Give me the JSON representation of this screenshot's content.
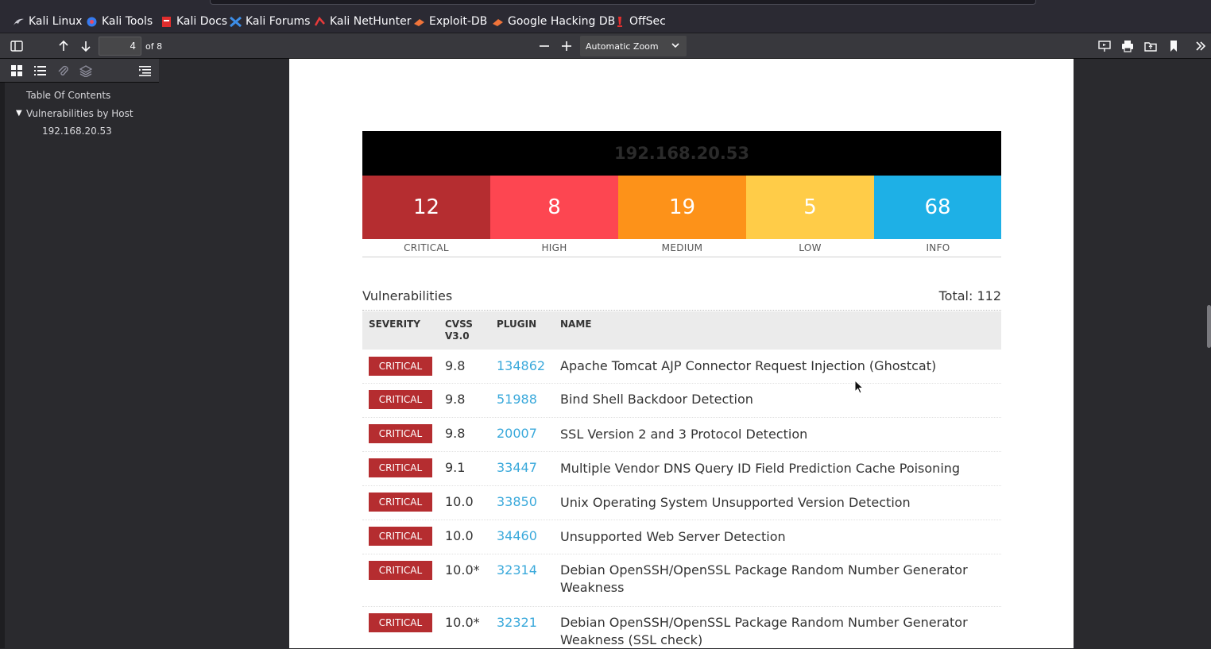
{
  "bookmarks": [
    {
      "label": "Kali Linux",
      "icon": "kali-dragon-icon"
    },
    {
      "label": "Kali Tools",
      "icon": "kali-tools-icon"
    },
    {
      "label": "Kali Docs",
      "icon": "kali-docs-icon"
    },
    {
      "label": "Kali Forums",
      "icon": "kali-forums-icon"
    },
    {
      "label": "Kali NetHunter",
      "icon": "kali-nethunter-icon"
    },
    {
      "label": "Exploit-DB",
      "icon": "exploit-db-icon"
    },
    {
      "label": "Google Hacking DB",
      "icon": "ghdb-icon"
    },
    {
      "label": "OffSec",
      "icon": "offsec-icon"
    }
  ],
  "toolbar": {
    "page_number": "4",
    "page_count_label": "of 8",
    "zoom_label": "Automatic Zoom"
  },
  "outline": {
    "items": [
      "Table Of Contents",
      "Vulnerabilities by Host",
      "192.168.20.53"
    ]
  },
  "report": {
    "host": "192.168.20.53",
    "severity_counts": [
      {
        "label": "CRITICAL",
        "count": "12",
        "color": "#b52d30"
      },
      {
        "label": "HIGH",
        "count": "8",
        "color": "#fd4651"
      },
      {
        "label": "MEDIUM",
        "count": "19",
        "color": "#fd9219"
      },
      {
        "label": "LOW",
        "count": "5",
        "color": "#ffcc48"
      },
      {
        "label": "INFO",
        "count": "68",
        "color": "#1eb0e6"
      }
    ],
    "vulnerabilities_title": "Vulnerabilities",
    "total_label": "Total: 112",
    "columns": [
      "SEVERITY",
      "CVSS V3.0",
      "PLUGIN",
      "NAME"
    ],
    "rows": [
      {
        "severity": "CRITICAL",
        "cvss": "9.8",
        "plugin": "134862",
        "name": "Apache Tomcat AJP Connector Request Injection (Ghostcat)"
      },
      {
        "severity": "CRITICAL",
        "cvss": "9.8",
        "plugin": "51988",
        "name": "Bind Shell Backdoor Detection"
      },
      {
        "severity": "CRITICAL",
        "cvss": "9.8",
        "plugin": "20007",
        "name": "SSL Version 2 and 3 Protocol Detection"
      },
      {
        "severity": "CRITICAL",
        "cvss": "9.1",
        "plugin": "33447",
        "name": "Multiple Vendor DNS Query ID Field Prediction Cache Poisoning"
      },
      {
        "severity": "CRITICAL",
        "cvss": "10.0",
        "plugin": "33850",
        "name": "Unix Operating System Unsupported Version Detection"
      },
      {
        "severity": "CRITICAL",
        "cvss": "10.0",
        "plugin": "34460",
        "name": "Unsupported Web Server Detection"
      },
      {
        "severity": "CRITICAL",
        "cvss": "10.0*",
        "plugin": "32314",
        "name": "Debian OpenSSH/OpenSSL Package Random Number Generator Weakness"
      },
      {
        "severity": "CRITICAL",
        "cvss": "10.0*",
        "plugin": "32321",
        "name": "Debian OpenSSH/OpenSSL Package Random Number Generator Weakness (SSL check)"
      }
    ]
  }
}
